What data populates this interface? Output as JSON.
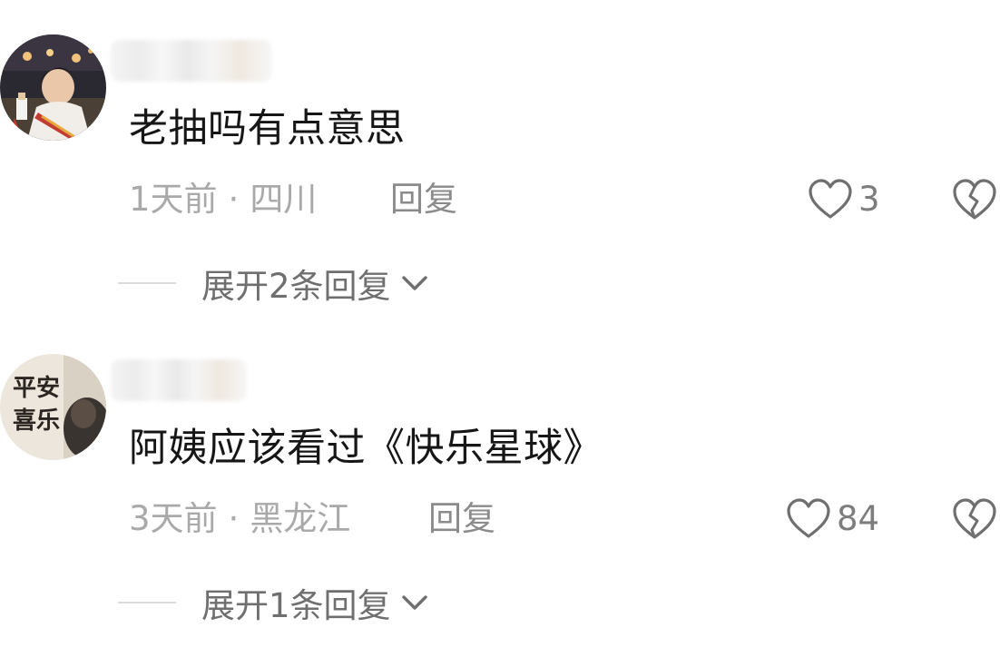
{
  "comments": [
    {
      "text": "老抽吗有点意思",
      "time": "1天前",
      "location": "四川",
      "reply_label": "回复",
      "likes": "3",
      "expand_label": "展开2条回复"
    },
    {
      "text": "阿姨应该看过《快乐星球》",
      "time": "3天前",
      "location": "黑龙江",
      "reply_label": "回复",
      "likes": "84",
      "expand_label": "展开1条回复"
    }
  ],
  "avatar2_text": "平安喜乐",
  "separator": "·",
  "icons": {
    "like": "heart-outline-icon",
    "dislike": "broken-heart-icon",
    "expand": "chevron-down-icon"
  },
  "colors": {
    "text": "#161616",
    "meta": "#a9a9a9",
    "icon": "#6f6f6f"
  }
}
